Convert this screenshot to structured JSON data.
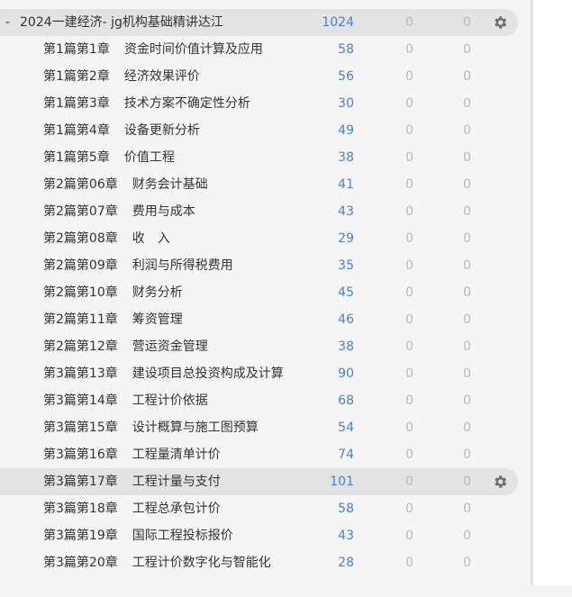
{
  "deck": {
    "toggle": "-",
    "title": "2024一建经济- jg机构基础精讲达江",
    "count_main": "1024",
    "count_a": "0",
    "count_b": "0",
    "gear_icon": "gear-icon"
  },
  "chapters": [
    {
      "prefix": "第1篇第1章",
      "name": "资金时间价值计算及应用",
      "count_main": "58",
      "count_a": "0",
      "count_b": "0"
    },
    {
      "prefix": "第1篇第2章",
      "name": "经济效果评价",
      "count_main": "56",
      "count_a": "0",
      "count_b": "0"
    },
    {
      "prefix": "第1篇第3章",
      "name": "技术方案不确定性分析",
      "count_main": "30",
      "count_a": "0",
      "count_b": "0"
    },
    {
      "prefix": "第1篇第4章",
      "name": "设备更新分析",
      "count_main": "49",
      "count_a": "0",
      "count_b": "0"
    },
    {
      "prefix": "第1篇第5章",
      "name": "价值工程",
      "count_main": "38",
      "count_a": "0",
      "count_b": "0"
    },
    {
      "prefix": "第2篇第06章",
      "name": "财务会计基础",
      "count_main": "41",
      "count_a": "0",
      "count_b": "0"
    },
    {
      "prefix": "第2篇第07章",
      "name": "费用与成本",
      "count_main": "43",
      "count_a": "0",
      "count_b": "0"
    },
    {
      "prefix": "第2篇第08章",
      "name": "收　入",
      "count_main": "29",
      "count_a": "0",
      "count_b": "0"
    },
    {
      "prefix": "第2篇第09章",
      "name": "利润与所得税费用",
      "count_main": "35",
      "count_a": "0",
      "count_b": "0"
    },
    {
      "prefix": "第2篇第10章",
      "name": "财务分析",
      "count_main": "45",
      "count_a": "0",
      "count_b": "0"
    },
    {
      "prefix": "第2篇第11章",
      "name": "筹资管理",
      "count_main": "46",
      "count_a": "0",
      "count_b": "0"
    },
    {
      "prefix": "第2篇第12章",
      "name": "营运资金管理",
      "count_main": "38",
      "count_a": "0",
      "count_b": "0"
    },
    {
      "prefix": "第3篇第13章",
      "name": "建设项目总投资构成及计算",
      "count_main": "90",
      "count_a": "0",
      "count_b": "0"
    },
    {
      "prefix": "第3篇第14章",
      "name": "工程计价依据",
      "count_main": "68",
      "count_a": "0",
      "count_b": "0"
    },
    {
      "prefix": "第3篇第15章",
      "name": "设计概算与施工图预算",
      "count_main": "54",
      "count_a": "0",
      "count_b": "0"
    },
    {
      "prefix": "第3篇第16章",
      "name": "工程量清单计价",
      "count_main": "74",
      "count_a": "0",
      "count_b": "0"
    },
    {
      "prefix": "第3篇第17章",
      "name": "工程计量与支付",
      "count_main": "101",
      "count_a": "0",
      "count_b": "0",
      "hovered": true
    },
    {
      "prefix": "第3篇第18章",
      "name": "工程总承包计价",
      "count_main": "58",
      "count_a": "0",
      "count_b": "0"
    },
    {
      "prefix": "第3篇第19章",
      "name": "国际工程投标报价",
      "count_main": "43",
      "count_a": "0",
      "count_b": "0"
    },
    {
      "prefix": "第3篇第20章",
      "name": "工程计价数字化与智能化",
      "count_main": "28",
      "count_a": "0",
      "count_b": "0"
    }
  ],
  "colors": {
    "count_main": "#4a7fd4",
    "count_zero": "#b8b8b8",
    "highlight": "#e3e3e3",
    "panel": "#f5f5f5"
  }
}
